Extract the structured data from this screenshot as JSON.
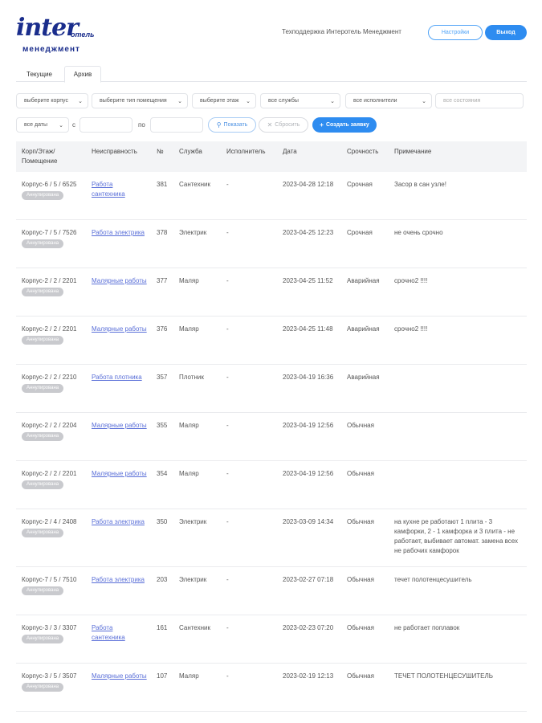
{
  "header": {
    "logo_inter": "inter",
    "logo_otel": "отель",
    "logo_management": "менеджмент",
    "support_text": "Техподдержка Интеротель Менеджмент",
    "settings_label": "Настройки",
    "exit_label": "Выход"
  },
  "tabs": [
    {
      "label": "Текущие",
      "active": false
    },
    {
      "label": "Архив",
      "active": true
    }
  ],
  "filters": {
    "building": "выберите корпус",
    "room_type": "выберите тип помещения",
    "floor": "выберите этаж",
    "services": "все службы",
    "executors": "все исполнители",
    "statuses_placeholder": "все состояния",
    "dates": "все даты",
    "from_label": "с",
    "to_label": "по",
    "show_label": "Показать",
    "reset_label": "Сбросить",
    "create_label": "Создать заявку"
  },
  "table": {
    "columns": [
      "Корп/Этаж/Помещение",
      "Неисправность",
      "№",
      "Служба",
      "Исполнитель",
      "Дата",
      "Срочность",
      "Примечание"
    ],
    "rows": [
      {
        "location": "Корпус-6 / 5 / 6525",
        "status": "Аннулирована",
        "fault": "Работа сантехника",
        "num": "381",
        "service": "Сантехник",
        "executor": "-",
        "date": "2023-04-28 12:18",
        "urgency": "Срочная",
        "note": "Засор в сан узле!"
      },
      {
        "location": "Корпус-7 / 5 / 7526",
        "status": "Аннулирована",
        "fault": "Работа электрика",
        "num": "378",
        "service": "Электрик",
        "executor": "-",
        "date": "2023-04-25 12:23",
        "urgency": "Срочная",
        "note": "не очень срочно"
      },
      {
        "location": "Корпус-2 / 2 / 2201",
        "status": "Аннулирована",
        "fault": "Малярные работы",
        "num": "377",
        "service": "Маляр",
        "executor": "-",
        "date": "2023-04-25 11:52",
        "urgency": "Аварийная",
        "note": "срочно2 !!!!"
      },
      {
        "location": "Корпус-2 / 2 / 2201",
        "status": "Аннулирована",
        "fault": "Малярные работы",
        "num": "376",
        "service": "Маляр",
        "executor": "-",
        "date": "2023-04-25 11:48",
        "urgency": "Аварийная",
        "note": "срочно2 !!!!"
      },
      {
        "location": "Корпус-2 / 2 / 2210",
        "status": "Аннулирована",
        "fault": "Работа плотника",
        "num": "357",
        "service": "Плотник",
        "executor": "-",
        "date": "2023-04-19 16:36",
        "urgency": "Аварийная",
        "note": ""
      },
      {
        "location": "Корпус-2 / 2 / 2204",
        "status": "Аннулирована",
        "fault": "Малярные работы",
        "num": "355",
        "service": "Маляр",
        "executor": "-",
        "date": "2023-04-19 12:56",
        "urgency": "Обычная",
        "note": ""
      },
      {
        "location": "Корпус-2 / 2 / 2201",
        "status": "Аннулирована",
        "fault": "Малярные работы",
        "num": "354",
        "service": "Маляр",
        "executor": "-",
        "date": "2023-04-19 12:56",
        "urgency": "Обычная",
        "note": ""
      },
      {
        "location": "Корпус-2 / 4 / 2408",
        "status": "Аннулирована",
        "fault": "Работа электрика",
        "num": "350",
        "service": "Электрик",
        "executor": "-",
        "date": "2023-03-09 14:34",
        "urgency": "Обычная",
        "note": "на кухне ре работают 1 плита - 3 камфорки, 2 - 1 камфорка и 3 плита - не работает, выбивает автомат. замена всех не рабочих камфорок"
      },
      {
        "location": "Корпус-7 / 5 / 7510",
        "status": "Аннулирована",
        "fault": "Работа электрика",
        "num": "203",
        "service": "Электрик",
        "executor": "-",
        "date": "2023-02-27 07:18",
        "urgency": "Обычная",
        "note": "течет полотенцесушитель"
      },
      {
        "location": "Корпус-3 / 3 / 3307",
        "status": "Аннулирована",
        "fault": "Работа сантехника",
        "num": "161",
        "service": "Сантехник",
        "executor": "-",
        "date": "2023-02-23 07:20",
        "urgency": "Обычная",
        "note": "не работает поплавок"
      },
      {
        "location": "Корпус-3 / 5 / 3507",
        "status": "Аннулирована",
        "fault": "Малярные работы",
        "num": "107",
        "service": "Маляр",
        "executor": "-",
        "date": "2023-02-19 12:13",
        "urgency": "Обычная",
        "note": "ТЕЧЕТ ПОЛОТЕНЦЕСУШИТЕЛЬ"
      }
    ]
  },
  "colors": {
    "brand": "#1a2d8c",
    "accent": "#2e8cf0",
    "badge": "#c9cace",
    "link": "#5a6fd8"
  },
  "icons": {
    "select_chevron": "chevron-down-icon",
    "show": "search-icon",
    "reset": "close-icon",
    "create": "plus-icon"
  }
}
